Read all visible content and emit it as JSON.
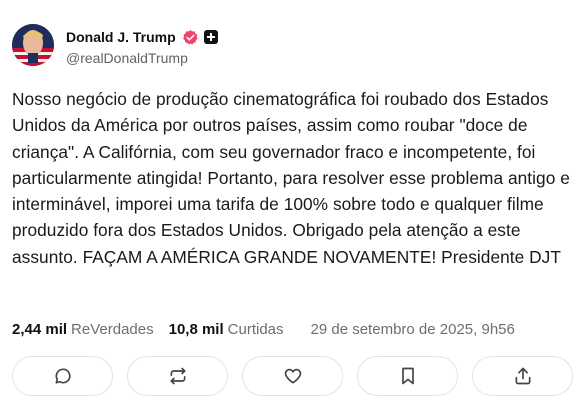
{
  "post": {
    "author_name": "Donald J. Trump",
    "handle": "@realDonaldTrump",
    "text": "Nosso negócio de produção cinematográfica foi roubado dos Estados Unidos da América por outros países, assim como roubar \"doce de criança\". A Califórnia, com seu governador fraco e incompetente, foi particularmente atingida! Portanto, para resolver esse problema antigo e interminável, imporei uma tarifa de 100% sobre todo e qualquer filme produzido fora dos Estados Unidos. Obrigado pela atenção a este assunto. FAÇAM A AMÉRICA GRANDE NOVAMENTE! Presidente DJT",
    "reposts_count": "2,44 mil",
    "reposts_label": "ReVerdades",
    "likes_count": "10,8 mil",
    "likes_label": "Curtidas",
    "timestamp": "29 de setembro de 2025, 9h56"
  },
  "icons": {
    "verified": "verified-badge-icon",
    "plus": "plus-badge-icon",
    "reply": "comment-icon",
    "repost": "repost-icon",
    "like": "heart-icon",
    "bookmark": "bookmark-icon",
    "share": "share-icon"
  },
  "colors": {
    "verified_badge": "#e8476b",
    "text": "#1a1a1a",
    "muted": "#6b6f75",
    "border": "#e2e4e8"
  }
}
